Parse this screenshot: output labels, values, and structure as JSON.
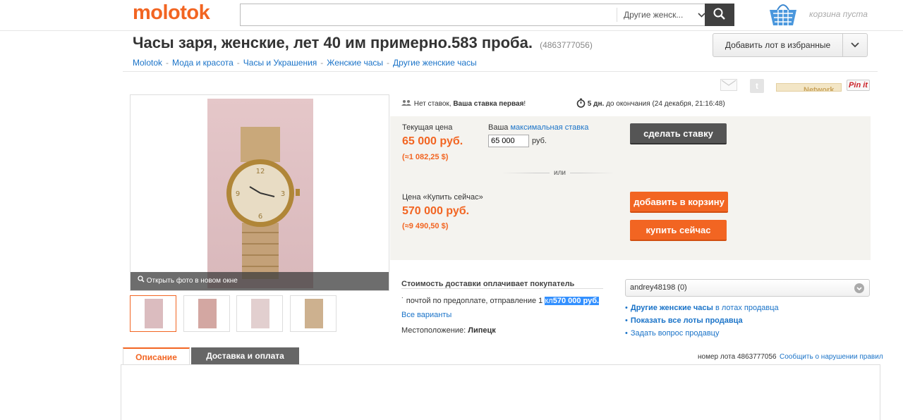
{
  "header": {
    "logo": "molotok",
    "search_value": "",
    "search_category": "Другие женск...",
    "cart_text": "корзина пуста"
  },
  "lot": {
    "title": "Часы заря, женские, лет 40 им примерно.583 проба.",
    "id_text": "(4863777056)",
    "fav_label": "Добавить лот в избранные"
  },
  "breadcrumb": [
    "Molotok",
    "Мода и красота",
    "Часы и Украшения",
    "Женские часы",
    "Другие женские часы"
  ],
  "photo": {
    "open_label": "Открыть фото в новом окне"
  },
  "share": {
    "network_text": "Network",
    "pinit": "Pin it"
  },
  "info": {
    "no_bids": "Нет ставок,",
    "first_bid": "Ваша ставка первая",
    "days": "5 дн.",
    "until": "до окончания (24 декабря, 21:16:48)"
  },
  "bid": {
    "current_label": "Текущая цена",
    "current_price": "65 000 руб.",
    "current_usd": "(≈1 082,25 $)",
    "your_label": "Ваша",
    "max_link": "максимальная ставка",
    "input_value": "65 000",
    "currency": "руб.",
    "or": "или",
    "buy_now_label": "Цена «Купить сейчас»",
    "buy_now_price": "570 000 руб.",
    "buy_now_usd": "(≈9 490,50 $)",
    "bid_button": "сделать ставку",
    "cart_button": "добавить в корзину",
    "buy_button": "купить сейчас"
  },
  "delivery": {
    "title": "Стоимость доставки оплачивает покупатель",
    "method": "почтой по предоплате, отправление 1",
    "highlight_prefix": "кл",
    "highlight_price": "570 000 руб.",
    "all_variants": "Все варианты",
    "location_label": "Местоположение:",
    "location_value": "Липецк"
  },
  "seller": {
    "name": "andrey48198 (0)",
    "link1_bold": "Другие женские часы",
    "link1_rest": "в лотах продавца",
    "link2": "Показать все лоты продавца",
    "link3": "Задать вопрос продавцу"
  },
  "tabs": {
    "description": "Описание",
    "shipping": "Доставка и оплата"
  },
  "footer": {
    "lot_number": "номер лота 4863777056",
    "report": "Сообщить о нарушении правил"
  },
  "colors": {
    "accent": "#f26522",
    "link": "#1a73c8",
    "dark_button": "#555555"
  }
}
